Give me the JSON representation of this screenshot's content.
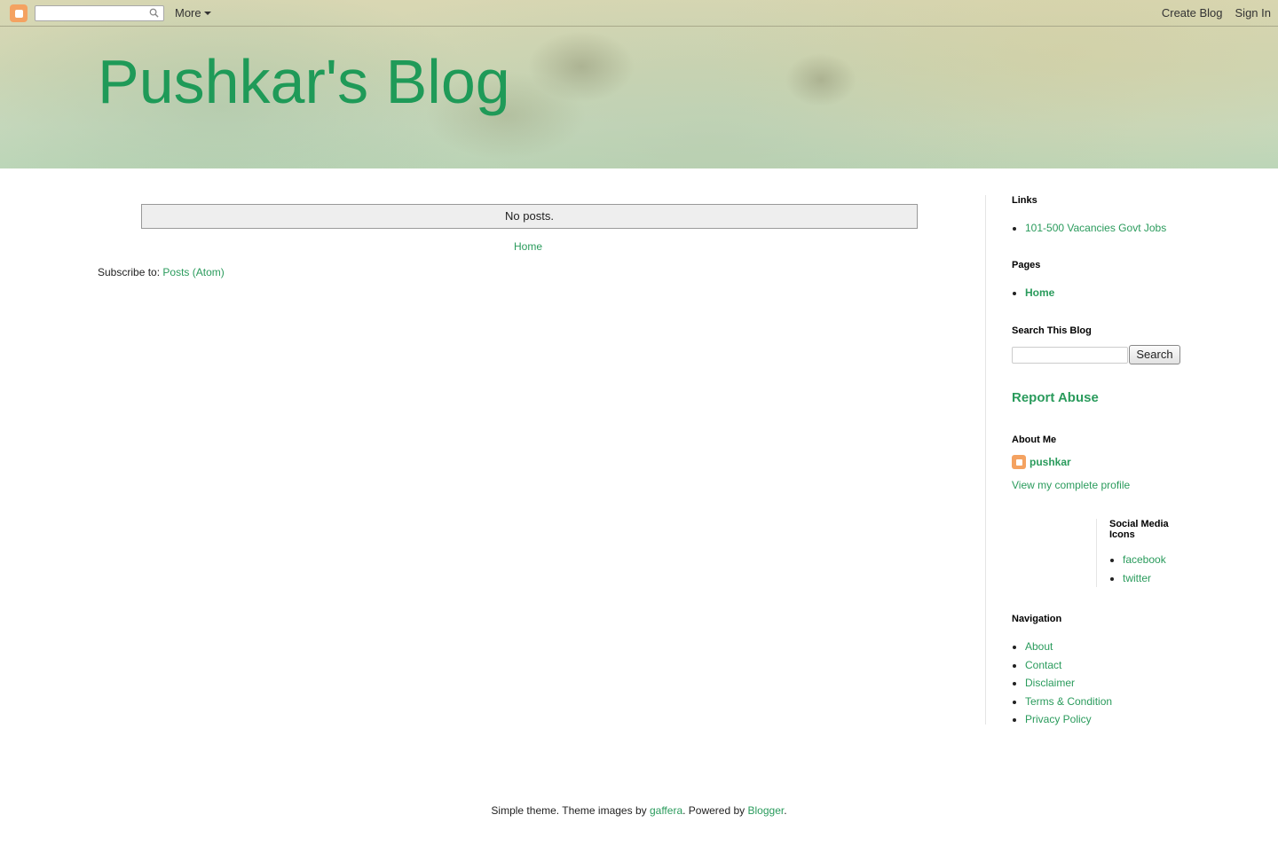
{
  "navbar": {
    "more_label": "More",
    "create_blog": "Create Blog",
    "sign_in": "Sign In"
  },
  "blog": {
    "title": "Pushkar's Blog"
  },
  "main": {
    "status": "No posts.",
    "home_link": "Home",
    "subscribe_label": "Subscribe to:",
    "subscribe_link": "Posts (Atom)"
  },
  "sidebar": {
    "links": {
      "title": "Links",
      "items": [
        "101-500 Vacancies Govt Jobs"
      ]
    },
    "pages": {
      "title": "Pages",
      "items": [
        "Home"
      ]
    },
    "search": {
      "title": "Search This Blog",
      "button_label": "Search"
    },
    "report_abuse": "Report Abuse",
    "about": {
      "title": "About Me",
      "name": "pushkar",
      "profile_link": "View my complete profile"
    },
    "social": {
      "title": "Social Media Icons",
      "items": [
        "facebook",
        "twitter"
      ]
    },
    "navigation": {
      "title": "Navigation",
      "items": [
        "About",
        "Contact",
        "Disclaimer",
        "Terms & Condition",
        "Privacy Policy"
      ]
    }
  },
  "footer": {
    "prefix": "Simple theme. Theme images by",
    "images_by": "gaffera",
    "middle": ". Powered by",
    "powered_by": "Blogger",
    "suffix": "."
  },
  "colors": {
    "link": "#2a9b5c",
    "title": "#1f9a58",
    "blogger_orange": "#f4a261"
  }
}
